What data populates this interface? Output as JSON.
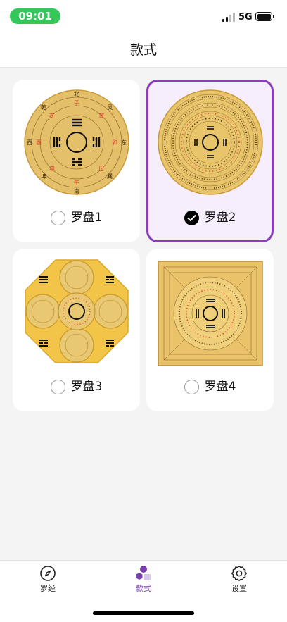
{
  "status_bar": {
    "time": "09:01",
    "network": "5G"
  },
  "header": {
    "title": "款式"
  },
  "styles": [
    {
      "label": "罗盘1",
      "selected": false,
      "icon": "compass-round-plate"
    },
    {
      "label": "罗盘2",
      "selected": true,
      "icon": "compass-fine-ring-plate"
    },
    {
      "label": "罗盘3",
      "selected": false,
      "icon": "compass-octagon-plate"
    },
    {
      "label": "罗盘4",
      "selected": false,
      "icon": "compass-square-plate"
    }
  ],
  "tabs": [
    {
      "label": "罗经",
      "icon": "compass-icon",
      "active": false
    },
    {
      "label": "款式",
      "icon": "shapes-icon",
      "active": true
    },
    {
      "label": "设置",
      "icon": "gear-icon",
      "active": false
    }
  ],
  "colors": {
    "accent": "#8a3fb8",
    "status_pill": "#35c759",
    "plate_gold": "#e8c46a",
    "plate_red": "#e0402a"
  }
}
